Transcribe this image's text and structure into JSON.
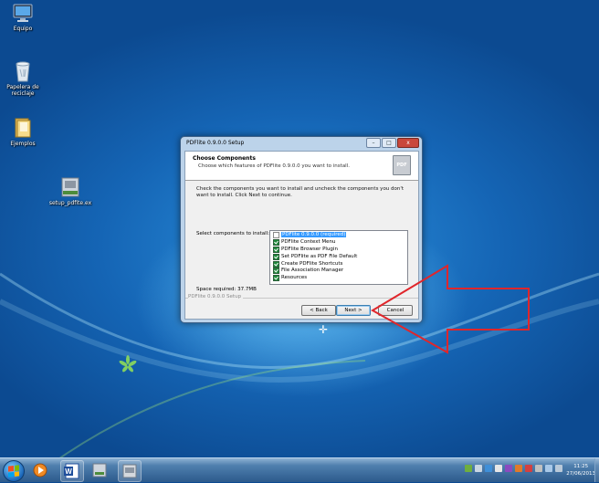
{
  "desktop": {
    "icons": [
      {
        "label": "Equipo"
      },
      {
        "label": "Papelera de reciclaje"
      },
      {
        "label": "Ejemplos"
      },
      {
        "label": "setup_pdfite.ex"
      }
    ]
  },
  "window": {
    "title": "PDFlite 0.9.0.0 Setup",
    "buttons": {
      "minimize": "–",
      "maximize": "□",
      "close": "x"
    },
    "header": {
      "title": "Choose Components",
      "subtitle": "Choose which features of PDFlite 0.9.0.0 you want to install.",
      "logo_text": "PDF"
    },
    "description": "Check the components you want to install and uncheck the components you don't want to install. Click Next to continue.",
    "select_label": "Select components to install:",
    "space_required": "Space required: 37.7MB",
    "components": [
      {
        "label": "PDFlite 0.9.0.0 (required)",
        "checked": false,
        "selected": true
      },
      {
        "label": "PDFlite Context Menu",
        "checked": true,
        "selected": false
      },
      {
        "label": "PDFlite Browser Plugin",
        "checked": true,
        "selected": false
      },
      {
        "label": "Set PDFlite as PDF File Default",
        "checked": true,
        "selected": false
      },
      {
        "label": "Create PDFlite Shortcuts",
        "checked": true,
        "selected": false
      },
      {
        "label": "File Association Manager",
        "checked": true,
        "selected": false
      },
      {
        "label": "Resources",
        "checked": true,
        "selected": false
      }
    ],
    "footer_brand": "PDFlite 0.9.0.0 Setup",
    "back_label": "< Back",
    "next_label": "Next >",
    "cancel_label": "Cancel"
  },
  "annotation": {
    "color": "#e0262b"
  },
  "taskbar": {
    "time": "11:25",
    "date": "27/06/2013"
  }
}
